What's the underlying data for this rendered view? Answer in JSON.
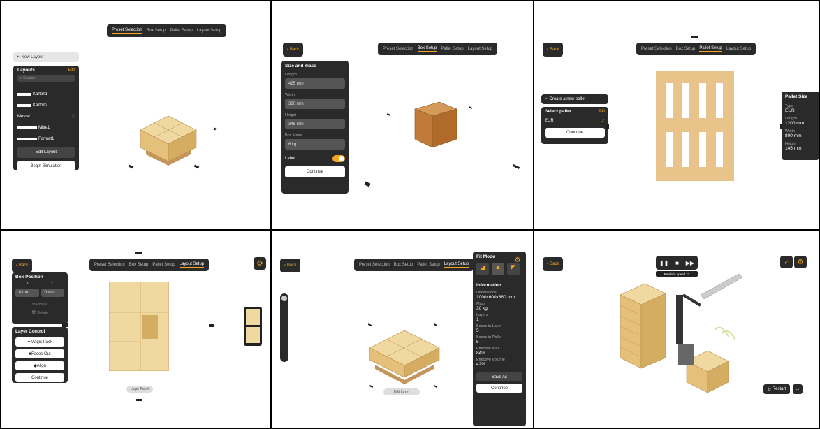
{
  "tabs": {
    "preset": "Preset Selection",
    "box": "Box Setup",
    "pallet": "Pallet Setup",
    "layout": "Layout Setup"
  },
  "back_label": "Back",
  "p1": {
    "new_layout": "New Layout",
    "layouts_header": "Layouts",
    "edit": "Edit",
    "search_placeholder": "Search",
    "items": [
      "Karton1",
      "Karton2",
      "Messe1",
      "Mitte1",
      "Format1"
    ],
    "edit_layout": "Edit Layout",
    "begin_simulation": "Begin Simulation"
  },
  "p2": {
    "section": "Size and mass",
    "length_label": "Length",
    "length": "425 mm",
    "width_label": "Width",
    "width": "380 mm",
    "height_label": "Height",
    "height": "345 mm",
    "mass_label": "Box Mass",
    "mass": "6 kg",
    "label_label": "Label",
    "continue": "Continue"
  },
  "p3": {
    "create": "Create a new pallet",
    "select": "Select pallet",
    "edit": "Edit",
    "item": "EUR",
    "continue": "Continue",
    "size_header": "Pallet Size",
    "type_label": "Type",
    "type": "EUR",
    "length_label": "Length",
    "length": "1200 mm",
    "width_label": "Width",
    "width": "800 mm",
    "height_label": "Height",
    "height": "145 mm"
  },
  "p4": {
    "box_position": "Box Position",
    "x": "X",
    "y": "Y",
    "x_val": "0 mm",
    "y_val": "0 mm",
    "rotate": "Rotate",
    "delete": "Delete",
    "layer_control": "Layer Control",
    "magic_pack": "Magic Pack",
    "faces_out": "Faces Out",
    "align": "Align",
    "continue": "Continue",
    "bottom_btn": "Layer Panel"
  },
  "p5": {
    "fit_mode": "Fit Mode",
    "information": "Information",
    "dimensions_label": "Dimensions",
    "dimensions": "1000x600x360 mm",
    "mass_label": "Mass",
    "mass": "30 kg",
    "layers_label": "Layers",
    "layers": "1",
    "boxes_per_layer_label": "Boxes in Layer",
    "boxes_per_layer": "5",
    "boxes_total_label": "Boxes in Pallet",
    "boxes_total": "5",
    "fill_label": "Effective area",
    "fill": "84%",
    "eff_label": "Effective Volume",
    "eff": "42%",
    "save": "Save As",
    "continue": "Continue",
    "bottom_btn": "Edit Layer"
  },
  "p6": {
    "speed": "Realistic speed x1",
    "restart": "Restart",
    "more": "..."
  }
}
